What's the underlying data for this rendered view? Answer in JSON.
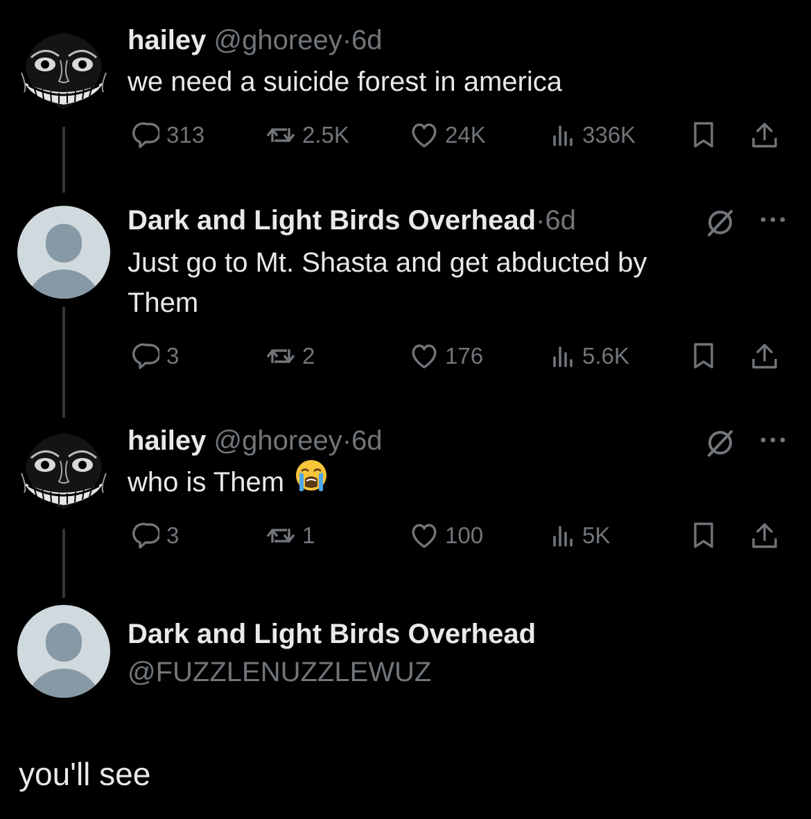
{
  "posts": [
    {
      "name": "hailey",
      "handle": "@ghoreey",
      "dot": "·",
      "time": "6d",
      "text": "we need a suicide forest in america",
      "replies": "313",
      "reposts": "2.5K",
      "likes": "24K",
      "views": "336K"
    },
    {
      "name": "Dark and Light Birds Overhead",
      "dot": "·",
      "time": "6d",
      "text": "Just go to Mt. Shasta and get abducted by Them",
      "replies": "3",
      "reposts": "2",
      "likes": "176",
      "views": "5.6K"
    },
    {
      "name": "hailey",
      "handle": "@ghoreey",
      "dot": "·",
      "time": "6d",
      "text": "who is Them",
      "emoji": "loudly-crying-face",
      "replies": "3",
      "reposts": "1",
      "likes": "100",
      "views": "5K"
    }
  ],
  "focused_post": {
    "name": "Dark and Light Birds Overhead",
    "handle": "@FUZZLENUZZLEWUZ",
    "text": "you'll see"
  },
  "colors": {
    "background": "#000000",
    "text": "#e7e9ea",
    "muted": "#71767b",
    "thread_line": "#333639",
    "default_avatar_bg": "#cfd9de",
    "default_avatar_fg": "#8899a6"
  },
  "icons": [
    "reply-icon",
    "repost-icon",
    "like-icon",
    "views-icon",
    "bookmark-icon",
    "share-icon",
    "grok-icon",
    "more-icon"
  ]
}
